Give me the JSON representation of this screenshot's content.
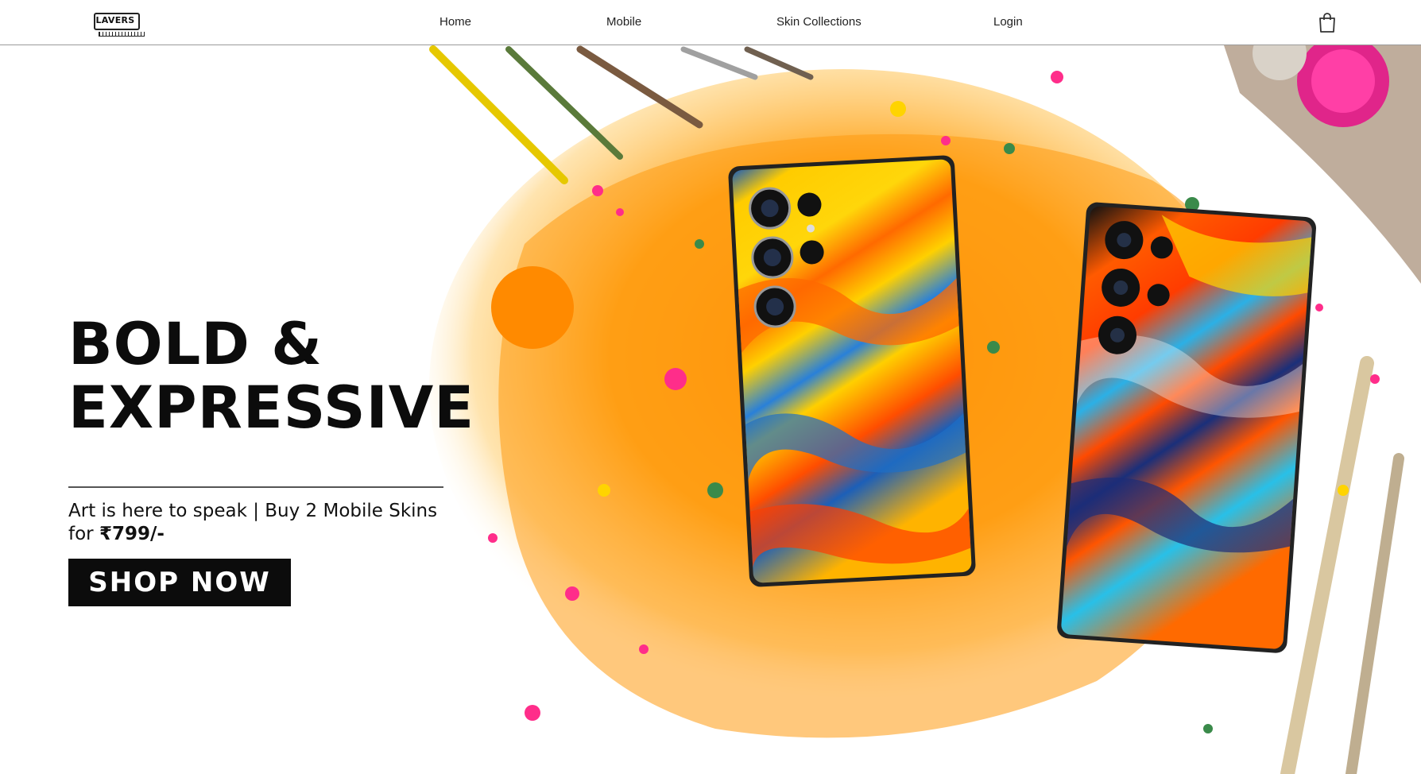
{
  "brand": {
    "logo_text": "LAVERS"
  },
  "nav": {
    "items": [
      {
        "label": "Home"
      },
      {
        "label": "Mobile"
      },
      {
        "label": "Skin Collections"
      },
      {
        "label": "Login"
      }
    ],
    "cart_icon": "shopping-bag-icon"
  },
  "hero": {
    "headline_line1": "BOLD &",
    "headline_line2": "EXPRESSIVE",
    "tagline_text": "Art is here to speak | Buy 2 Mobile Skins for ",
    "tagline_price": "₹799/-",
    "cta_label": "SHOP NOW",
    "image_alt": "Two phones with colorful marbled paint skins on a paint-splattered surface with brushes"
  },
  "colors": {
    "text": "#0c0c0c",
    "button_bg": "#0c0c0c",
    "button_text": "#ffffff",
    "accent_orange": "#f7931e",
    "accent_yellow": "#ffd400",
    "accent_pink": "#ff2d8a"
  }
}
